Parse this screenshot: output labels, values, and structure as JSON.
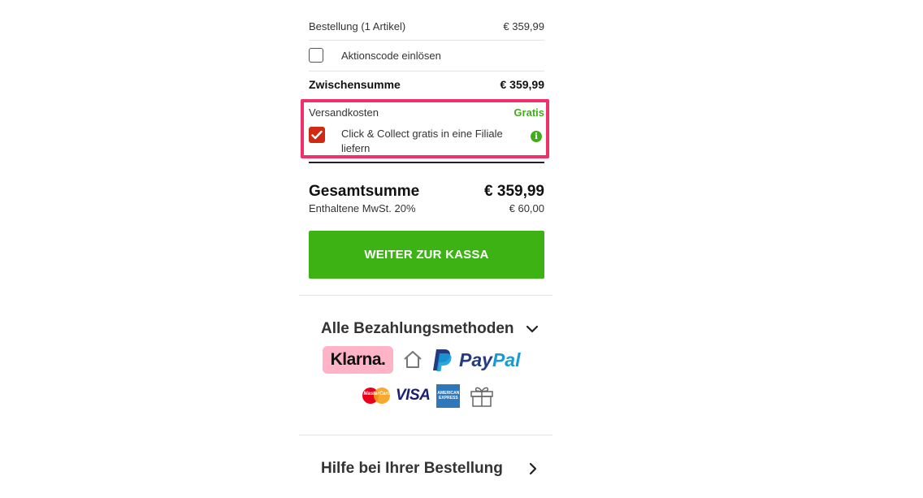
{
  "order": {
    "label": "Bestellung (1 Artikel)",
    "value": "€ 359,99"
  },
  "promo": {
    "label": "Aktionscode einlösen"
  },
  "subtotal": {
    "label": "Zwischensumme",
    "value": "€ 359,99"
  },
  "shipping": {
    "label": "Versandkosten",
    "value": "Gratis",
    "option_line1": "Click & Collect gratis in eine Filiale",
    "option_line2": "liefern",
    "info_glyph": "i"
  },
  "total": {
    "label": "Gesamtsumme",
    "value": "€ 359,99",
    "vat_label": "Enthaltene MwSt. 20%",
    "vat_value": "€ 60,00"
  },
  "checkout_button": {
    "label": "WEITER ZUR KASSA"
  },
  "payment": {
    "title": "Alle Bezahlungsmethoden",
    "klarna": "Klarna.",
    "paypal_pay": "Pay",
    "paypal_pal": "Pal",
    "mastercard": "MasterCard",
    "visa": "VISA",
    "amex_line1": "AMERICAN",
    "amex_line2": "EXPRESS"
  },
  "help": {
    "title": "Hilfe bei Ihrer Bestellung"
  },
  "colors": {
    "accent_green": "#3cb215",
    "checkbox_red": "#d12a13",
    "highlight_pink": "#f0306b",
    "klarna_pink": "#ffb3c7",
    "paypal_dark": "#253b80",
    "paypal_light": "#179bd7"
  }
}
